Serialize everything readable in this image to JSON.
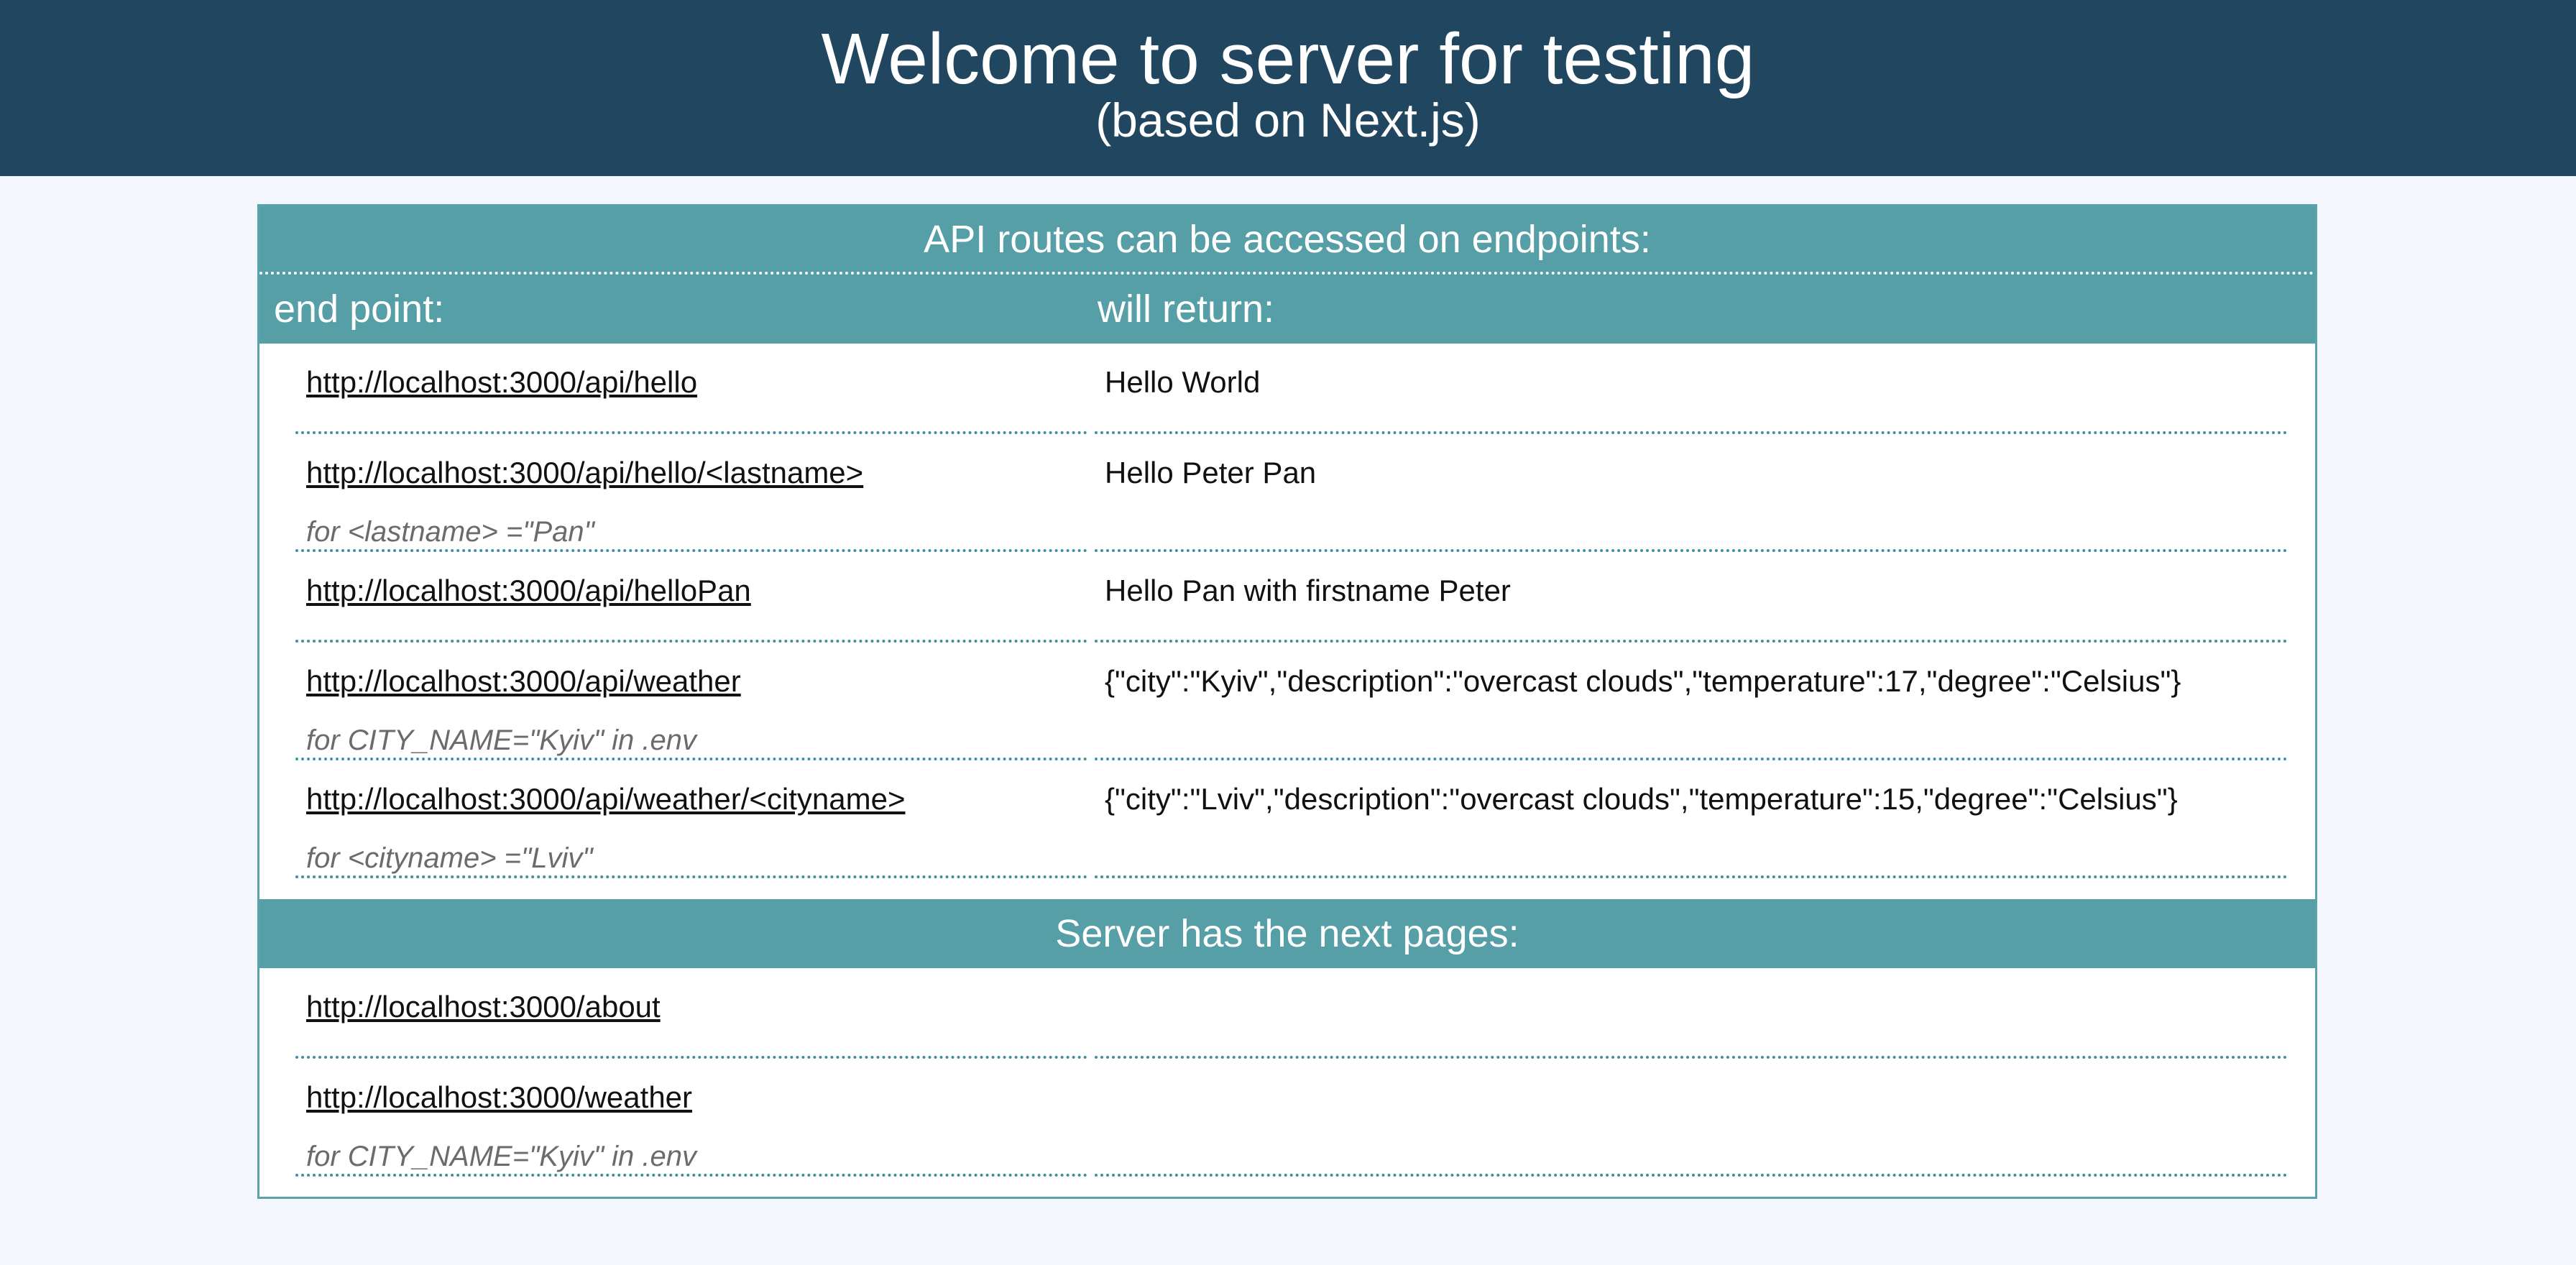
{
  "header": {
    "title": "Welcome to server for testing",
    "subtitle": "(based on Next.js)",
    "background": "#21465f"
  },
  "api_section": {
    "heading": "API routes can be accessed on endpoints:",
    "col_endpoint": "end point:",
    "col_return": "will return:",
    "band_color": "#569fa7",
    "rows": [
      {
        "endpoint": "http://localhost:3000/api/hello",
        "note": "",
        "returns": "Hello World"
      },
      {
        "endpoint": "http://localhost:3000/api/hello/<lastname>",
        "note": "for <lastname> =\"Pan\"",
        "returns": "Hello Peter Pan"
      },
      {
        "endpoint": "http://localhost:3000/api/helloPan",
        "note": "",
        "returns": "Hello Pan with firstname Peter"
      },
      {
        "endpoint": "http://localhost:3000/api/weather",
        "note": "for CITY_NAME=\"Kyiv\" in .env",
        "returns": "{\"city\":\"Kyiv\",\"description\":\"overcast clouds\",\"temperature\":17,\"degree\":\"Celsius\"}"
      },
      {
        "endpoint": "http://localhost:3000/api/weather/<cityname>",
        "note": "for <cityname> =\"Lviv\"",
        "returns": "{\"city\":\"Lviv\",\"description\":\"overcast clouds\",\"temperature\":15,\"degree\":\"Celsius\"}"
      }
    ]
  },
  "pages_section": {
    "heading": "Server has the next pages:",
    "rows": [
      {
        "page": "http://localhost:3000/about",
        "note": ""
      },
      {
        "page": "http://localhost:3000/weather",
        "note": "for CITY_NAME=\"Kyiv\" in .env"
      }
    ]
  }
}
